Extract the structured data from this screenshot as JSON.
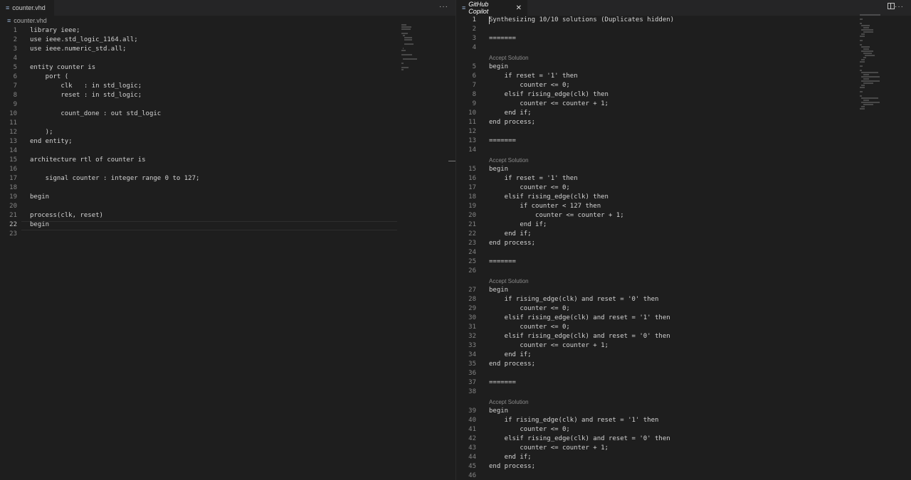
{
  "left_editor": {
    "tab": {
      "title": "counter.vhd",
      "icon": "lines-icon",
      "dirty": true
    },
    "breadcrumb": {
      "file": "counter.vhd"
    },
    "active_line": 22,
    "lines": [
      {
        "n": "1",
        "t": "library ieee;"
      },
      {
        "n": "2",
        "t": "use ieee.std_logic_1164.all;"
      },
      {
        "n": "3",
        "t": "use ieee.numeric_std.all;"
      },
      {
        "n": "4",
        "t": ""
      },
      {
        "n": "5",
        "t": "entity counter is"
      },
      {
        "n": "6",
        "t": "    port ("
      },
      {
        "n": "7",
        "t": "        clk   : in std_logic;"
      },
      {
        "n": "8",
        "t": "        reset : in std_logic;"
      },
      {
        "n": "9",
        "t": ""
      },
      {
        "n": "10",
        "t": "        count_done : out std_logic"
      },
      {
        "n": "11",
        "t": ""
      },
      {
        "n": "12",
        "t": "    );"
      },
      {
        "n": "13",
        "t": "end entity;"
      },
      {
        "n": "14",
        "t": ""
      },
      {
        "n": "15",
        "t": "architecture rtl of counter is"
      },
      {
        "n": "16",
        "t": ""
      },
      {
        "n": "17",
        "t": "    signal counter : integer range 0 to 127;"
      },
      {
        "n": "18",
        "t": ""
      },
      {
        "n": "19",
        "t": "begin"
      },
      {
        "n": "20",
        "t": ""
      },
      {
        "n": "21",
        "t": "process(clk, reset)"
      },
      {
        "n": "22",
        "t": "begin"
      },
      {
        "n": "23",
        "t": ""
      }
    ]
  },
  "right_panel": {
    "tab": {
      "title": "GitHub Copilot",
      "close_icon": "close-icon"
    },
    "accept_label": "Accept Solution",
    "rows": [
      {
        "n": "1",
        "t": "Synthesizing 10/10 solutions (Duplicates hidden)"
      },
      {
        "n": "2",
        "t": ""
      },
      {
        "n": "3",
        "t": "======="
      },
      {
        "n": "4",
        "t": ""
      },
      {
        "accept": true
      },
      {
        "n": "5",
        "t": "begin"
      },
      {
        "n": "6",
        "t": "    if reset = '1' then"
      },
      {
        "n": "7",
        "t": "        counter <= 0;"
      },
      {
        "n": "8",
        "t": "    elsif rising_edge(clk) then"
      },
      {
        "n": "9",
        "t": "        counter <= counter + 1;"
      },
      {
        "n": "10",
        "t": "    end if;"
      },
      {
        "n": "11",
        "t": "end process;"
      },
      {
        "n": "12",
        "t": ""
      },
      {
        "n": "13",
        "t": "======="
      },
      {
        "n": "14",
        "t": ""
      },
      {
        "accept": true
      },
      {
        "n": "15",
        "t": "begin"
      },
      {
        "n": "16",
        "t": "    if reset = '1' then"
      },
      {
        "n": "17",
        "t": "        counter <= 0;"
      },
      {
        "n": "18",
        "t": "    elsif rising_edge(clk) then"
      },
      {
        "n": "19",
        "t": "        if counter < 127 then"
      },
      {
        "n": "20",
        "t": "            counter <= counter + 1;"
      },
      {
        "n": "21",
        "t": "        end if;"
      },
      {
        "n": "22",
        "t": "    end if;"
      },
      {
        "n": "23",
        "t": "end process;"
      },
      {
        "n": "24",
        "t": ""
      },
      {
        "n": "25",
        "t": "======="
      },
      {
        "n": "26",
        "t": ""
      },
      {
        "accept": true
      },
      {
        "n": "27",
        "t": "begin"
      },
      {
        "n": "28",
        "t": "    if rising_edge(clk) and reset = '0' then"
      },
      {
        "n": "29",
        "t": "        counter <= 0;"
      },
      {
        "n": "30",
        "t": "    elsif rising_edge(clk) and reset = '1' then"
      },
      {
        "n": "31",
        "t": "        counter <= 0;"
      },
      {
        "n": "32",
        "t": "    elsif rising_edge(clk) and reset = '0' then"
      },
      {
        "n": "33",
        "t": "        counter <= counter + 1;"
      },
      {
        "n": "34",
        "t": "    end if;"
      },
      {
        "n": "35",
        "t": "end process;"
      },
      {
        "n": "36",
        "t": ""
      },
      {
        "n": "37",
        "t": "======="
      },
      {
        "n": "38",
        "t": ""
      },
      {
        "accept": true
      },
      {
        "n": "39",
        "t": "begin"
      },
      {
        "n": "40",
        "t": "    if rising_edge(clk) and reset = '1' then"
      },
      {
        "n": "41",
        "t": "        counter <= 0;"
      },
      {
        "n": "42",
        "t": "    elsif rising_edge(clk) and reset = '0' then"
      },
      {
        "n": "43",
        "t": "        counter <= counter + 1;"
      },
      {
        "n": "44",
        "t": "    end if;"
      },
      {
        "n": "45",
        "t": "end process;"
      },
      {
        "n": "46",
        "t": ""
      }
    ]
  },
  "colors": {
    "background": "#1e1e1e",
    "tabbar": "#252526",
    "text": "#d4d4d4",
    "line_number": "#858585",
    "accept_link": "#8b8b8b"
  }
}
